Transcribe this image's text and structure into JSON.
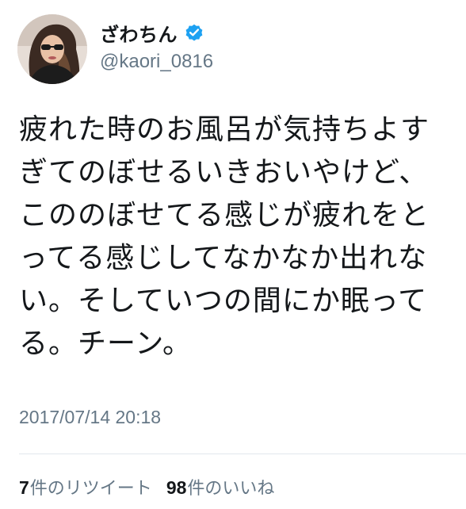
{
  "user": {
    "display_name": "ざわちん",
    "handle": "@kaori_0816",
    "verified_icon": "verified-badge-icon",
    "verified_color": "#1da1f2"
  },
  "tweet": {
    "lines": [
      "疲れた時のお風呂が気持ちよす",
      "ぎてのぼせるいきおいやけど、",
      "こののぼせてる感じが疲れをと",
      "ってる感じしてなかなか出れな",
      "い。そしていつの間にか眠って",
      "る。チーン。"
    ],
    "timestamp": "2017/07/14 20:18"
  },
  "stats": {
    "retweets_count": "7",
    "retweets_label": "件のリツイート",
    "likes_count": "98",
    "likes_label": "件のいいね"
  }
}
